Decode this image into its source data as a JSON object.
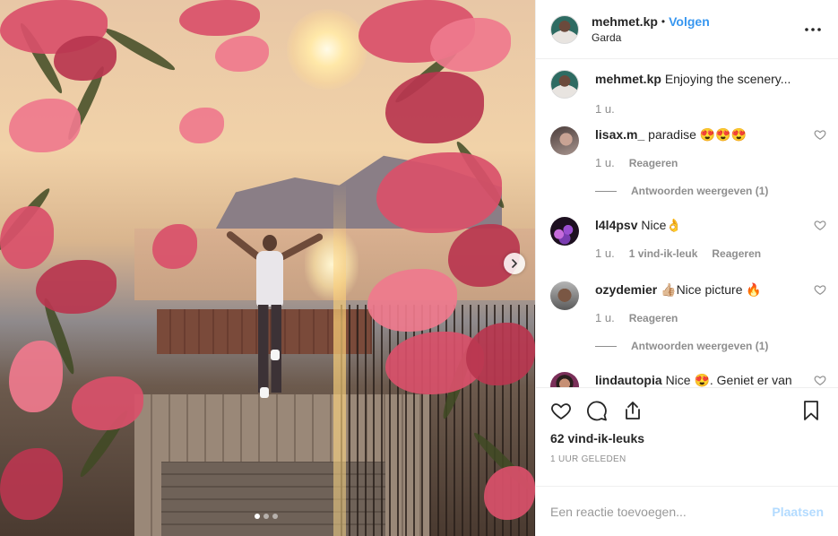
{
  "post": {
    "username": "mehmet.kp",
    "separator": "•",
    "follow_label": "Volgen",
    "location": "Garda",
    "more_icon": "more-options-icon",
    "carousel": {
      "total_images": 3,
      "active_index": 0
    }
  },
  "caption": {
    "username": "mehmet.kp",
    "text": "Enjoying the scenery...",
    "time": "1 u."
  },
  "comments": [
    {
      "username": "lisax.m_",
      "text": "paradise 😍😍😍",
      "time": "1 u.",
      "likes_label": "",
      "reply_label": "Reageren",
      "view_replies": "Antwoorden weergeven (1)"
    },
    {
      "username": "l4l4psv",
      "text": "Nice👌",
      "time": "1 u.",
      "likes_label": "1 vind-ik-leuk",
      "reply_label": "Reageren",
      "view_replies": ""
    },
    {
      "username": "ozydemier",
      "text": "👍🏼Nice picture 🔥",
      "time": "1 u.",
      "likes_label": "",
      "reply_label": "Reageren",
      "view_replies": "Antwoorden weergeven (1)"
    },
    {
      "username": "lindautopia",
      "text": "Nice 😍. Geniet er van lieverd",
      "time": "",
      "likes_label": "",
      "reply_label": "",
      "view_replies": ""
    }
  ],
  "actions": {
    "likes": "62 vind-ik-leuks",
    "timestamp": "1 UUR GELEDEN"
  },
  "add_comment": {
    "placeholder": "Een reactie toevoegen...",
    "post_label": "Plaatsen"
  },
  "colors": {
    "accent": "#3897f0",
    "disabled_accent": "#b3dbff",
    "muted": "#8e8e8e"
  }
}
